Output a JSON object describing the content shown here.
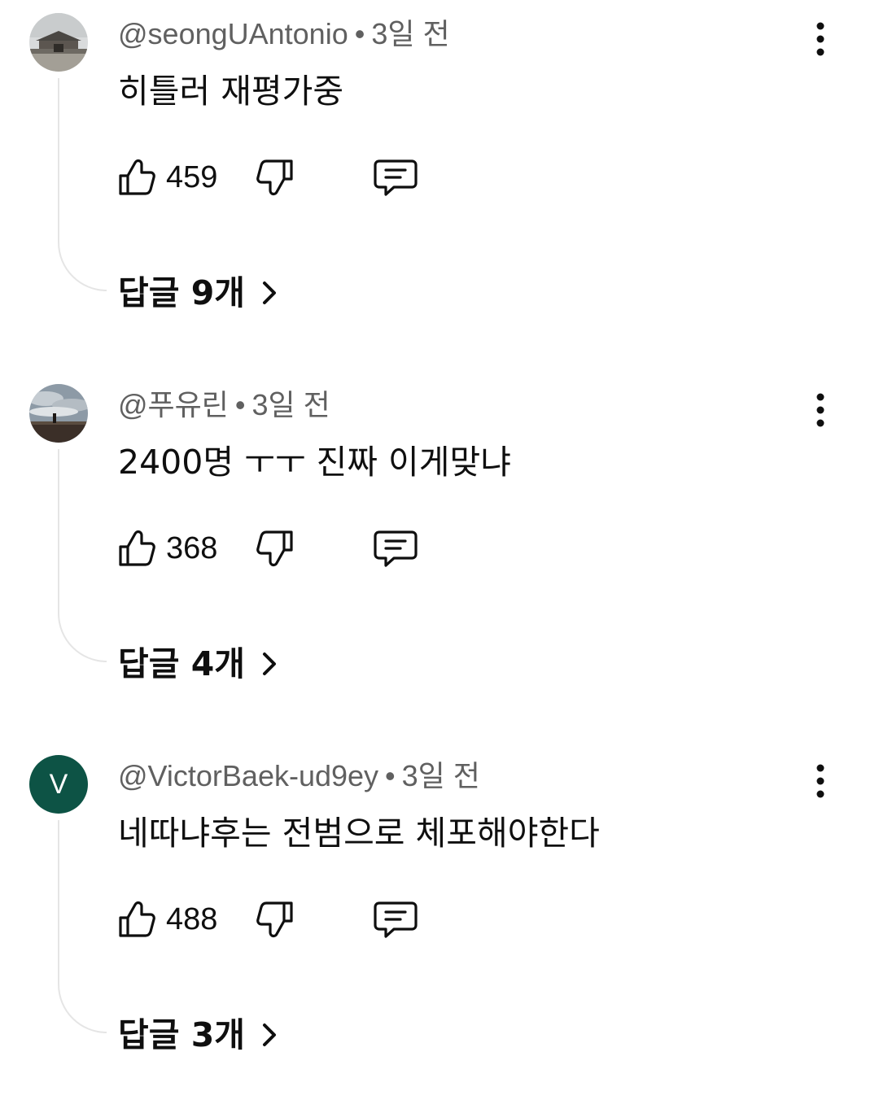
{
  "comments": [
    {
      "handle": "@seongUAntonio",
      "separator": "•",
      "time": "3일 전",
      "text": "히틀러 재평가중",
      "likes": "459",
      "replies_label": "답글 9개",
      "avatar": "photo-building"
    },
    {
      "handle": "@푸유린",
      "separator": "•",
      "time": "3일 전",
      "text": "2400명 ㅜㅜ 진짜 이게맞냐",
      "likes": "368",
      "replies_label": "답글 4개",
      "avatar": "photo-sky"
    },
    {
      "handle": "@VictorBaek-ud9ey",
      "separator": "•",
      "time": "3일 전",
      "text": "네따냐후는 전범으로 체포해야한다",
      "likes": "488",
      "replies_label": "답글 3개",
      "avatar": "letter",
      "avatar_letter": "V",
      "avatar_color": "#0d5345"
    }
  ],
  "icons": {
    "like": "thumbs-up-icon",
    "dislike": "thumbs-down-icon",
    "reply": "comment-icon",
    "more": "more-vert-icon",
    "replies": "chevron-right-icon"
  },
  "colors": {
    "text": "#0f0f0f",
    "meta": "#606060",
    "thread_line": "#e5e5e5"
  }
}
